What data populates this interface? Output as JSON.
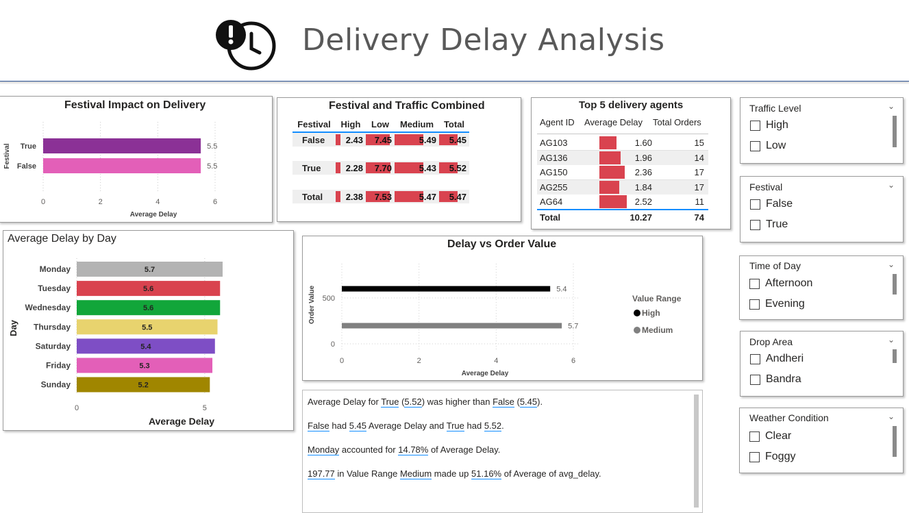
{
  "header": {
    "title": "Delivery Delay Analysis",
    "icon": "clock-alert-icon"
  },
  "festival_impact": {
    "title": "Festival Impact on Delivery",
    "chart_data": {
      "type": "bar",
      "orientation": "horizontal",
      "categories": [
        "True",
        "False"
      ],
      "values": [
        5.5,
        5.5
      ],
      "value_labels": [
        "5.5",
        "5.5"
      ],
      "colors": [
        "#8b3196",
        "#e35fb8"
      ],
      "ylabel": "Festival",
      "xlabel": "Average Delay",
      "xticks": [
        "0",
        "2",
        "4",
        "6"
      ],
      "xlim": [
        0,
        6.5
      ]
    }
  },
  "festival_traffic": {
    "title": "Festival and Traffic Combined",
    "columns": [
      "Festival",
      "High",
      "Low",
      "Medium",
      "Total"
    ],
    "rows": [
      {
        "label": "False",
        "values": [
          "2.43",
          "7.45",
          "5.49",
          "5.45"
        ]
      },
      {
        "label": "True",
        "values": [
          "2.28",
          "7.70",
          "5.43",
          "5.52"
        ]
      },
      {
        "label": "Total",
        "values": [
          "2.38",
          "7.53",
          "5.47",
          "5.47"
        ]
      }
    ],
    "bar_fractions": [
      [
        0.315,
        0.967,
        0.713,
        0.708
      ],
      [
        0.296,
        1.0,
        0.705,
        0.717
      ],
      [
        0.309,
        0.978,
        0.71,
        0.71
      ]
    ]
  },
  "top_agents": {
    "title": "Top 5 delivery agents",
    "columns": [
      "Agent ID",
      "Average Delay",
      "Total Orders"
    ],
    "rows": [
      {
        "id": "AG103",
        "delay": "1.60",
        "orders": "15",
        "frac": 0.635
      },
      {
        "id": "AG136",
        "delay": "1.96",
        "orders": "14",
        "frac": 0.778
      },
      {
        "id": "AG150",
        "delay": "2.36",
        "orders": "17",
        "frac": 0.937
      },
      {
        "id": "AG255",
        "delay": "1.84",
        "orders": "17",
        "frac": 0.73
      },
      {
        "id": "AG64",
        "delay": "2.52",
        "orders": "11",
        "frac": 1.0
      }
    ],
    "total": {
      "label": "Total",
      "delay": "10.27",
      "orders": "74"
    }
  },
  "delay_by_day": {
    "title": "Average Delay by Day",
    "chart_data": {
      "type": "bar",
      "orientation": "horizontal",
      "categories": [
        "Monday",
        "Tuesday",
        "Wednesday",
        "Thursday",
        "Saturday",
        "Friday",
        "Sunday"
      ],
      "values": [
        5.7,
        5.6,
        5.6,
        5.5,
        5.4,
        5.3,
        5.2
      ],
      "value_labels": [
        "5.7",
        "5.6",
        "5.6",
        "5.5",
        "5.4",
        "5.3",
        "5.2"
      ],
      "colors": [
        "#b3b3b3",
        "#d9434f",
        "#12a63a",
        "#e8d36e",
        "#7e4ec5",
        "#e35fb8",
        "#a08600"
      ],
      "ylabel": "Day",
      "xlabel": "Average Delay",
      "xticks": [
        "0",
        "5"
      ],
      "xlim": [
        0,
        5.7
      ]
    }
  },
  "delay_vs_order": {
    "title": "Delay vs Order Value",
    "chart_data": {
      "type": "bar",
      "orientation": "horizontal",
      "series": [
        {
          "name": "High",
          "order_value": 600,
          "value": 5.4,
          "label": "5.4",
          "color": "#000000"
        },
        {
          "name": "Medium",
          "order_value": 197.77,
          "value": 5.7,
          "label": "5.7",
          "color": "#808080"
        }
      ],
      "ylabel": "Order Value",
      "xlabel": "Average Delay",
      "xticks": [
        "0",
        "2",
        "4",
        "6"
      ],
      "yticks": [
        "500",
        "0"
      ],
      "xlim": [
        0,
        6.5
      ],
      "legend_title": "Value Range",
      "legend_position": "right"
    }
  },
  "narrative": {
    "p1": {
      "a": "Average Delay for ",
      "b": "True",
      "c": " (",
      "d": "5.52",
      "e": ") was higher than ",
      "f": "False",
      "g": " (",
      "h": "5.45",
      "i": ")."
    },
    "p2": {
      "a": "False",
      "b": " had ",
      "c": "5.45",
      "d": " Average Delay and ",
      "e": "True",
      "f": " had ",
      "g": "5.52",
      "h": "."
    },
    "p3": {
      "a": "Monday",
      "b": " accounted for ",
      "c": "14.78%",
      "d": " of Average Delay."
    },
    "p4": {
      "a": "197.77",
      "b": " in Value Range ",
      "c": "Medium",
      "d": " made up ",
      "e": "51.16%",
      "f": " of Average of avg_delay."
    }
  },
  "slicers": [
    {
      "title": "Traffic Level",
      "options": [
        "High",
        "Low"
      ]
    },
    {
      "title": "Festival",
      "options": [
        "False",
        "True"
      ]
    },
    {
      "title": "Time of Day",
      "options": [
        "Afternoon",
        "Evening"
      ]
    },
    {
      "title": "Drop Area",
      "options": [
        "Andheri",
        "Bandra"
      ]
    },
    {
      "title": "Weather Condition",
      "options": [
        "Clear",
        "Foggy"
      ]
    }
  ],
  "colors": {
    "accent": "#d9434f",
    "header_border": "#2f5597"
  }
}
